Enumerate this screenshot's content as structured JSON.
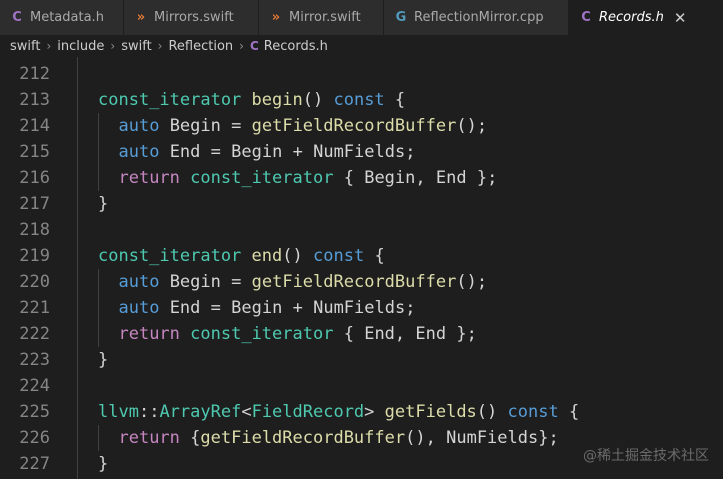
{
  "tabs": [
    {
      "icon": "C",
      "icon_name": "c-file-icon",
      "icon_color": "#a074c4",
      "label": "Metadata.h",
      "active": false
    },
    {
      "icon": "»",
      "icon_name": "swift-file-icon",
      "icon_color": "#e37933",
      "label": "Mirrors.swift",
      "active": false
    },
    {
      "icon": "»",
      "icon_name": "swift-file-icon",
      "icon_color": "#e37933",
      "label": "Mirror.swift",
      "active": false
    },
    {
      "icon": "G",
      "icon_name": "cpp-file-icon",
      "icon_color": "#519aba",
      "label": "ReflectionMirror.cpp",
      "active": false
    },
    {
      "icon": "C",
      "icon_name": "c-file-icon",
      "icon_color": "#a074c4",
      "label": "Records.h",
      "active": true,
      "close": "✕"
    }
  ],
  "breadcrumb": {
    "items": [
      "swift",
      "include",
      "swift",
      "Reflection"
    ],
    "file_icon": "C",
    "file": "Records.h"
  },
  "code": {
    "line_numbers": [
      "212",
      "213",
      "214",
      "215",
      "216",
      "217",
      "218",
      "219",
      "220",
      "221",
      "222",
      "223",
      "224",
      "225",
      "226",
      "227"
    ],
    "lines": [
      "",
      "  const_iterator begin() const {",
      "    auto Begin = getFieldRecordBuffer();",
      "    auto End = Begin + NumFields;",
      "    return const_iterator { Begin, End };",
      "  }",
      "",
      "  const_iterator end() const {",
      "    auto Begin = getFieldRecordBuffer();",
      "    auto End = Begin + NumFields;",
      "    return const_iterator { End, End };",
      "  }",
      "",
      "  llvm::ArrayRef<FieldRecord> getFields() const {",
      "    return {getFieldRecordBuffer(), NumFields};",
      "  }"
    ]
  },
  "watermark": "@稀土掘金技术社区",
  "colors": {
    "background": "#1e1e1e",
    "function": "#dcdcaa",
    "keyword": "#569cd6",
    "control": "#c586c0",
    "type": "#4ec9b0",
    "text": "#d4d4d4",
    "line_number": "#858585"
  }
}
